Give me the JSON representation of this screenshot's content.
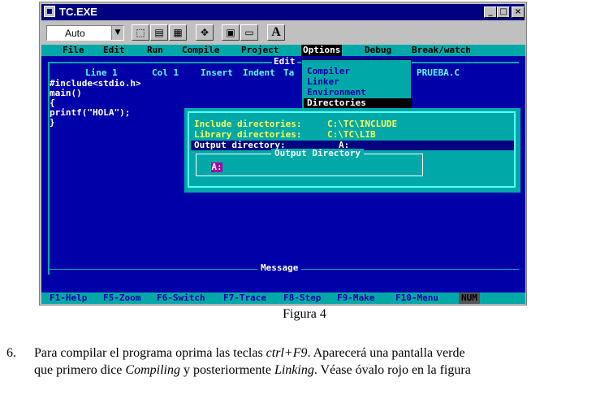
{
  "window": {
    "title": "TC.EXE",
    "controls": {
      "minimize": "_",
      "maximize": "□",
      "close": "×"
    }
  },
  "toolbar": {
    "font_combo_value": "Auto",
    "buttons": [
      "copy-icon",
      "paste-icon",
      "clipboard-icon",
      "fullscreen-icon",
      "properties-icon",
      "background-icon",
      "font-icon"
    ],
    "font_button_label": "A"
  },
  "menubar": {
    "items": [
      "File",
      "Edit",
      "Run",
      "Compile",
      "Project",
      "Options",
      "Debug",
      "Break/watch"
    ],
    "selected": "Options"
  },
  "editor": {
    "title": "Edit",
    "status": {
      "line": "Line 1",
      "col": "Col 1",
      "insert": "Insert",
      "indent": "Indent",
      "tab": "Ta",
      "file": "PRUEBA.C"
    },
    "code": [
      "#include<stdio.h>",
      "main()",
      "{",
      "printf(\"HOLA\");",
      "}"
    ]
  },
  "options_menu": {
    "items": [
      "Compiler",
      "Linker",
      "Environment",
      "Directories"
    ],
    "highlighted": "Directories"
  },
  "directories_dialog": {
    "rows": [
      {
        "label": "Include directories:",
        "value": "C:\\TC\\INCLUDE"
      },
      {
        "label": "Library directories:",
        "value": "C:\\TC\\LIB"
      },
      {
        "label": "Output directory:",
        "value": "A:"
      }
    ],
    "output_box": {
      "title": "Output Directory",
      "value": "A:"
    }
  },
  "message_panel": {
    "title": "Message"
  },
  "statusbar": {
    "keys": [
      "F1-Help",
      "F5-Zoom",
      "F6-Switch",
      "F7-Trace",
      "F8-Step",
      "F9-Make",
      "F10-Menu"
    ],
    "indicator": "NUM"
  },
  "caption": "Figura 4",
  "paragraph": {
    "number": "6.",
    "line1_a": "Para compilar el programa oprima las teclas ",
    "line1_key": "ctrl+F9",
    "line1_b": ". Aparecerá una pantalla verde",
    "line2_a": "que primero dice ",
    "line2_i1": "Compiling",
    "line2_b": " y posteriormente ",
    "line2_i2": "Linking",
    "line2_c": ". Véase óvalo rojo en la figura"
  }
}
